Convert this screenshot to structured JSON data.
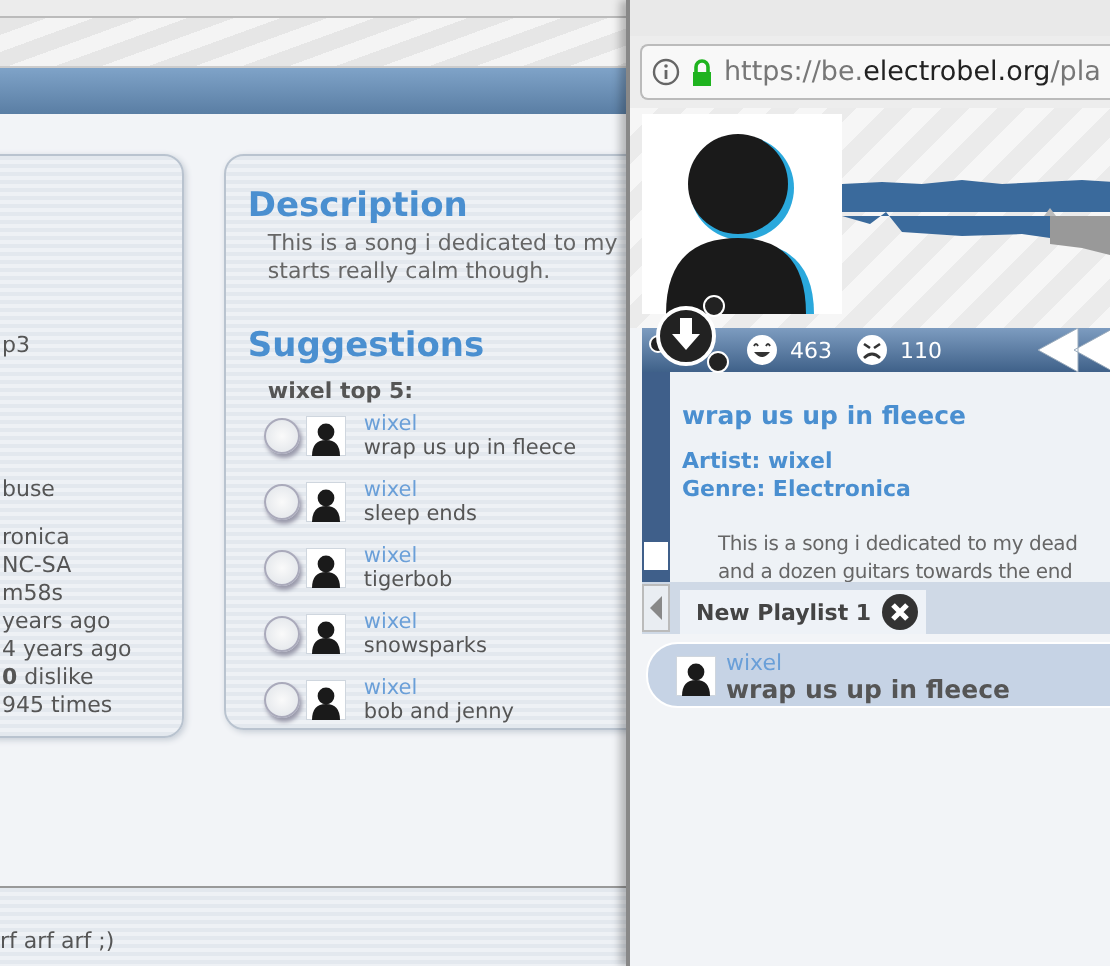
{
  "page": {
    "left_card": {
      "groups": [
        [
          "p3"
        ],
        [
          "buse"
        ],
        [
          "ronica",
          "NC-SA",
          "m58s",
          "years ago",
          "4 years ago",
          "**0** dislike",
          "945 times"
        ]
      ]
    },
    "description": {
      "heading": "Description",
      "lines": [
        "This is a song i dedicated to my",
        "starts really calm though."
      ]
    },
    "suggestions": {
      "heading": "Suggestions",
      "subheading": "wixel top 5:",
      "items": [
        {
          "artist": "wixel",
          "title": "wrap us up in fleece",
          "selected": false
        },
        {
          "artist": "wixel",
          "title": "sleep ends",
          "selected": false
        },
        {
          "artist": "wixel",
          "title": "tigerbob",
          "selected": false
        },
        {
          "artist": "wixel",
          "title": "snowsparks",
          "selected": false
        },
        {
          "artist": "wixel",
          "title": "bob and jenny",
          "selected": false
        }
      ]
    },
    "footer": {
      "text": "rf arf arf ;)"
    }
  },
  "browser": {
    "url": {
      "scheme": "https://be.",
      "domain": "electrobel.org",
      "path": "/pla"
    },
    "player": {
      "likes": "463",
      "dislikes": "110",
      "track": {
        "title": "wrap us up in fleece",
        "artist": "Artist: wixel",
        "genre": "Genre: Electronica",
        "description": [
          "This is a song i dedicated to my dead",
          "and a dozen guitars towards the end"
        ]
      },
      "playlist_tabs": [
        {
          "label": "New Playlist 1",
          "selected": true
        }
      ],
      "playlist": [
        {
          "artist": "wixel",
          "title": "wrap us up in fleece",
          "selected": true
        }
      ]
    }
  }
}
